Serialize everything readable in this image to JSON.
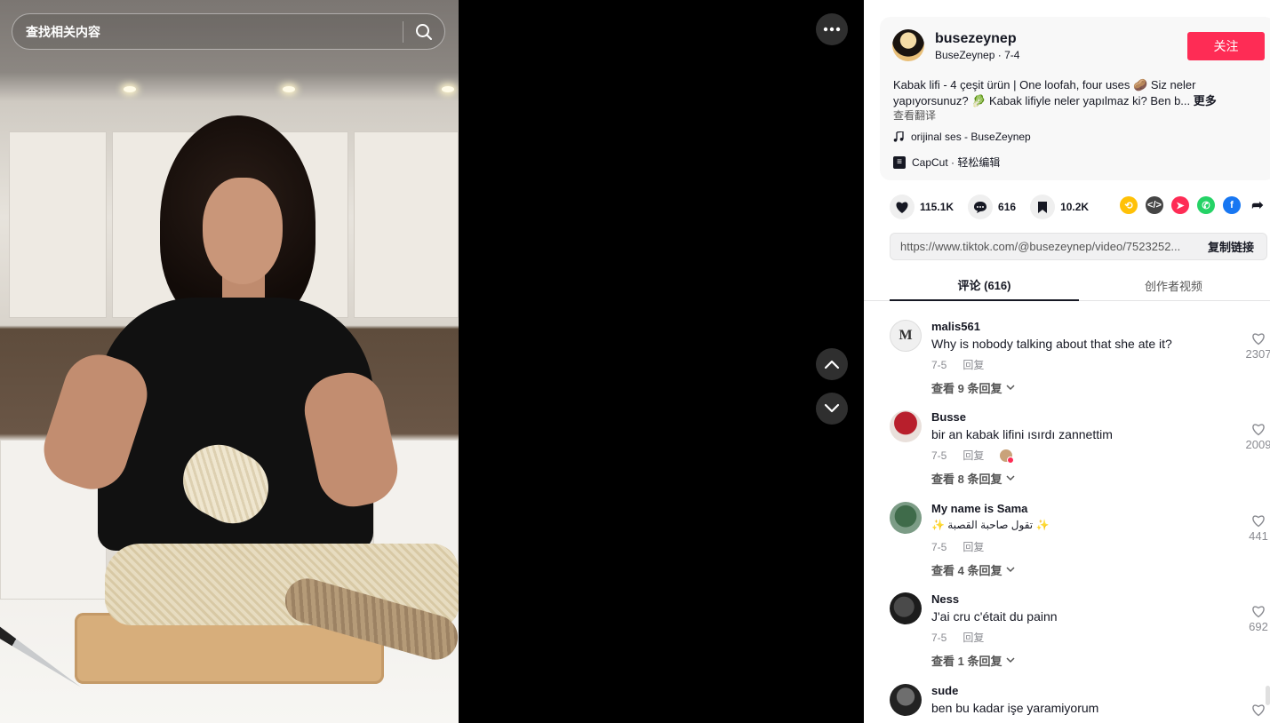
{
  "search": {
    "placeholder": "查找相关内容"
  },
  "video": {
    "more_label": "•••"
  },
  "author": {
    "username": "busezeynep",
    "display_name": "BuseZeynep",
    "date": "7-4",
    "follow_label": "关注",
    "description": "Kabak lifi - 4 çeşit ürün | One loofah, four uses 🥔 Siz neler yapıyorsunuz? 🥬 Kabak lifiyle neler yapılmaz ki? Ben b...",
    "more_label": "更多",
    "translate_label": "查看翻译",
    "music": "orijinal ses - BuseZeynep",
    "capcut": "CapCut · 轻松编辑"
  },
  "stats": {
    "likes": "115.1K",
    "comments": "616",
    "saves": "10.2K"
  },
  "share_colors": {
    "repost": "#ffc107",
    "embed": "#454545",
    "send": "#fe2c55",
    "whatsapp": "#25d366",
    "facebook": "#1877f2"
  },
  "link": {
    "url": "https://www.tiktok.com/@busezeynep/video/7523252...",
    "copy_label": "复制链接"
  },
  "tabs": {
    "comments": "评论 (616)",
    "creator_videos": "创作者视频"
  },
  "comments": [
    {
      "name": "malis561",
      "text": "Why is nobody talking about that she ate it?",
      "date": "7-5",
      "reply": "回复",
      "likes": "2307",
      "view_replies": "查看 9 条回复"
    },
    {
      "name": "Busse",
      "text": "bir an kabak lifini ısırdı zannettim",
      "date": "7-5",
      "reply": "回复",
      "likes": "2009",
      "view_replies": "查看 8 条回复"
    },
    {
      "name": "My name is Sama",
      "text": "✨ تقول صاحبة القصبة ✨",
      "date": "7-5",
      "reply": "回复",
      "likes": "441",
      "view_replies": "查看 4 条回复"
    },
    {
      "name": "Ness",
      "text": "J'ai cru c'était du painn",
      "date": "7-5",
      "reply": "回复",
      "likes": "692",
      "view_replies": "查看 1 条回复"
    },
    {
      "name": "sude",
      "text": "ben bu kadar işe yaramiyorum",
      "date": "",
      "reply": "",
      "likes": "",
      "view_replies": ""
    }
  ]
}
